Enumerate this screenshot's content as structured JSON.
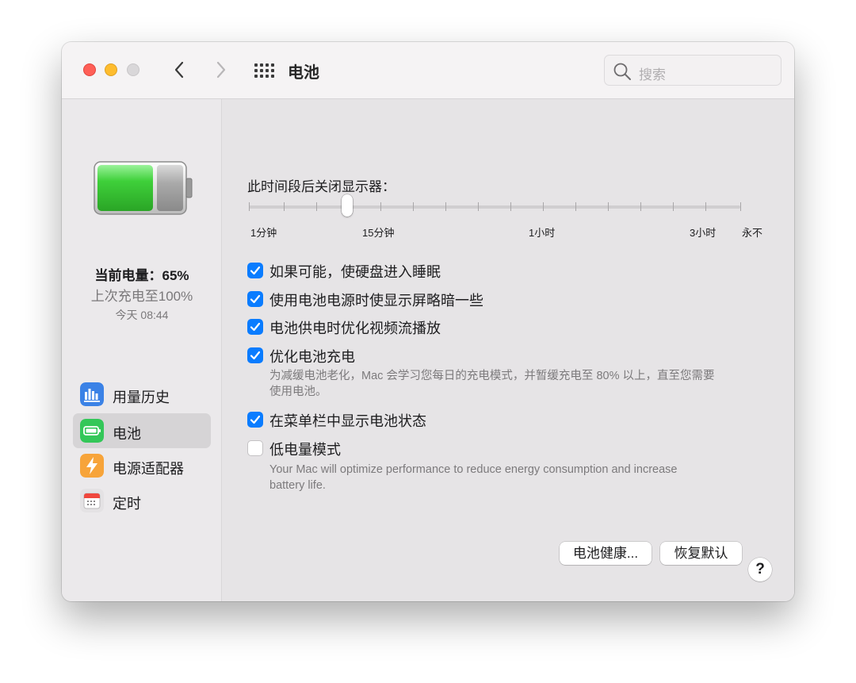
{
  "window": {
    "title": "电池",
    "search_placeholder": "搜索"
  },
  "sidebar": {
    "battery_status": {
      "current_charge": "当前电量：65%",
      "charge_level_percent": 65,
      "last_charged": "上次充电至100%",
      "last_charged_time": "今天 08:44"
    },
    "items": [
      {
        "label": "用量历史",
        "icon": "bar-chart-icon",
        "active": false
      },
      {
        "label": "电池",
        "icon": "battery-icon",
        "active": true
      },
      {
        "label": "电源适配器",
        "icon": "lightning-icon",
        "active": false
      },
      {
        "label": "定时",
        "icon": "calendar-icon",
        "active": false
      }
    ]
  },
  "main": {
    "display_off_label": "此时间段后关闭显示器：",
    "slider": {
      "tick_labels": [
        "1分钟",
        "15分钟",
        "1小时",
        "3小时",
        "永不"
      ],
      "current_value": "15分钟"
    },
    "options": [
      {
        "label": "如果可能，使硬盘进入睡眠",
        "checked": true
      },
      {
        "label": "使用电池电源时使显示屏略暗一些",
        "checked": true
      },
      {
        "label": "电池供电时优化视频流播放",
        "checked": true
      },
      {
        "label": "优化电池充电",
        "checked": true,
        "description": [
          "为减缓电池老化，Mac 会学习您每日的充电模式，并暂缓充电至 80% 以上，直至您需要",
          "使用电池。"
        ]
      },
      {
        "label": "在菜单栏中显示电池状态",
        "checked": true
      },
      {
        "label": "低电量模式",
        "checked": false,
        "description": [
          "Your Mac will optimize performance to reduce energy consumption and increase",
          "battery life."
        ]
      }
    ],
    "buttons": {
      "battery_health": "电池健康...",
      "restore_defaults": "恢复默认",
      "help": "?"
    }
  },
  "colors": {
    "accent": "#0a7cff",
    "battery_green": "#3fd03a",
    "close": "#ff5f57",
    "minimize": "#febc2e"
  }
}
